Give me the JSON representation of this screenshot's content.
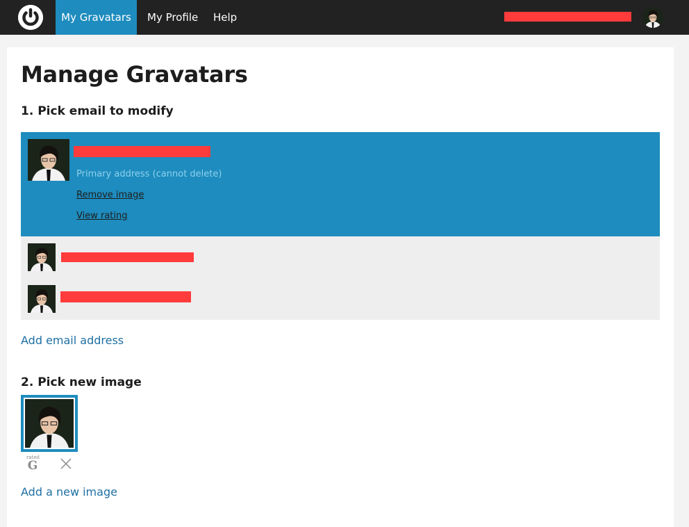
{
  "topbar": {
    "logo_icon": "gravatar-power-logo-icon",
    "nav_items": [
      {
        "label": "My Gravatars",
        "active": true
      },
      {
        "label": "My Profile",
        "active": false
      },
      {
        "label": "Help",
        "active": false
      }
    ],
    "account_avatar_icon": "user-avatar-icon"
  },
  "page": {
    "title": "Manage Gravatars",
    "step1_heading": "1. Pick email to modify",
    "step2_heading": "2. Pick new image"
  },
  "emails": {
    "selected": {
      "note": "Primary address (cannot delete)",
      "remove_label": "Remove image",
      "rating_label": "View rating"
    },
    "add_label": "Add email address"
  },
  "images": {
    "rating": {
      "small": "rated",
      "letter": "G"
    },
    "delete_icon": "close-icon",
    "add_label": "Add a new image"
  },
  "colors": {
    "topbar": "#222222",
    "accent": "#1e8cbe",
    "link": "#1e6fa3",
    "redaction": "#ff3b3b",
    "list_bg": "#eeeeee"
  }
}
